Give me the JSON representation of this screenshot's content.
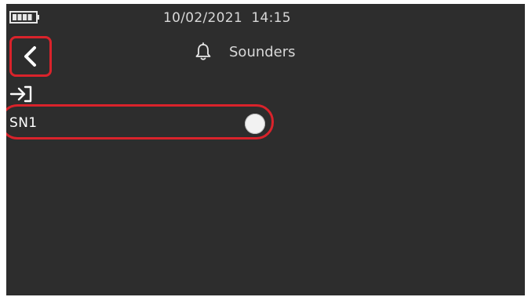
{
  "status_bar": {
    "date": "10/02/2021",
    "time": "14:15",
    "battery_icon": "battery-full-icon"
  },
  "header": {
    "title": "Sounders",
    "title_icon": "bell-icon",
    "back_icon": "chevron-left-icon"
  },
  "toolbar": {
    "enter_icon": "enter-arrow-icon"
  },
  "list": {
    "items": [
      {
        "label": "SN1",
        "control": "toggle"
      }
    ]
  },
  "colors": {
    "screen_background": "#2d2d2d",
    "highlight": "#d9232b",
    "text": "#d8d8d8"
  }
}
